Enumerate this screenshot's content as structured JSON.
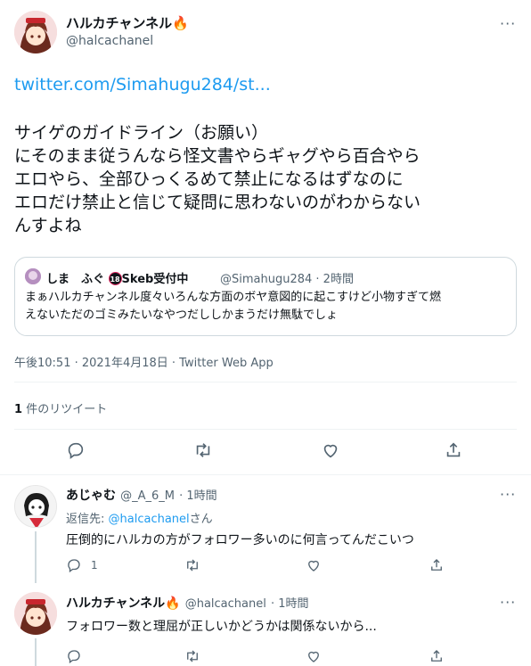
{
  "main_tweet": {
    "display_name": "ハルカチャンネル",
    "emoji": "🔥",
    "handle": "@halcachanel",
    "link": "twitter.com/Simahugu284/st...",
    "text_lines": [
      "サイゲのガイドライン（お願い）",
      "にそのまま従うんなら怪文書やらギャグやら百合やら",
      "エロやら、全部ひっくるめて禁止になるはずなのに",
      "エロだけ禁止と信じて疑問に思わないのがわからない",
      "んすよね"
    ],
    "timestamp": "午後10:51 · 2021年4月18日 · Twitter Web App",
    "retweet_count": "1",
    "retweet_label": "件のリツイート"
  },
  "quote": {
    "display_name": "しま　ふぐ",
    "badge": "18",
    "badge_suffix": "Skeb受付中",
    "handle": "@Simahugu284",
    "time": "· 2時間",
    "text_lines": [
      "まぁハルカチャンネル度々いろんな方面のボヤ意図的に起こすけど小物すぎて燃",
      "えないただのゴミみたいなやつだししかまうだけ無駄でしょ"
    ]
  },
  "reply1": {
    "display_name": "あじゃむ",
    "handle": "@_A_6_M",
    "time": "· 1時間",
    "reply_to_prefix": "返信先: ",
    "reply_to_mention": "@halcachanel",
    "reply_to_suffix": "さん",
    "text": "圧倒的にハルカの方がフォロワー多いのに何言ってんだこいつ",
    "reply_count": "1"
  },
  "reply2": {
    "display_name": "ハルカチャンネル",
    "emoji": "🔥",
    "handle": "@halcachanel",
    "time": "· 1時間",
    "text": "フォロワー数と理屈が正しいかどうかは関係ないから..."
  },
  "more_icon": "···",
  "icons": [
    "reply-icon",
    "retweet-icon",
    "like-icon",
    "share-icon",
    "more-icon"
  ]
}
